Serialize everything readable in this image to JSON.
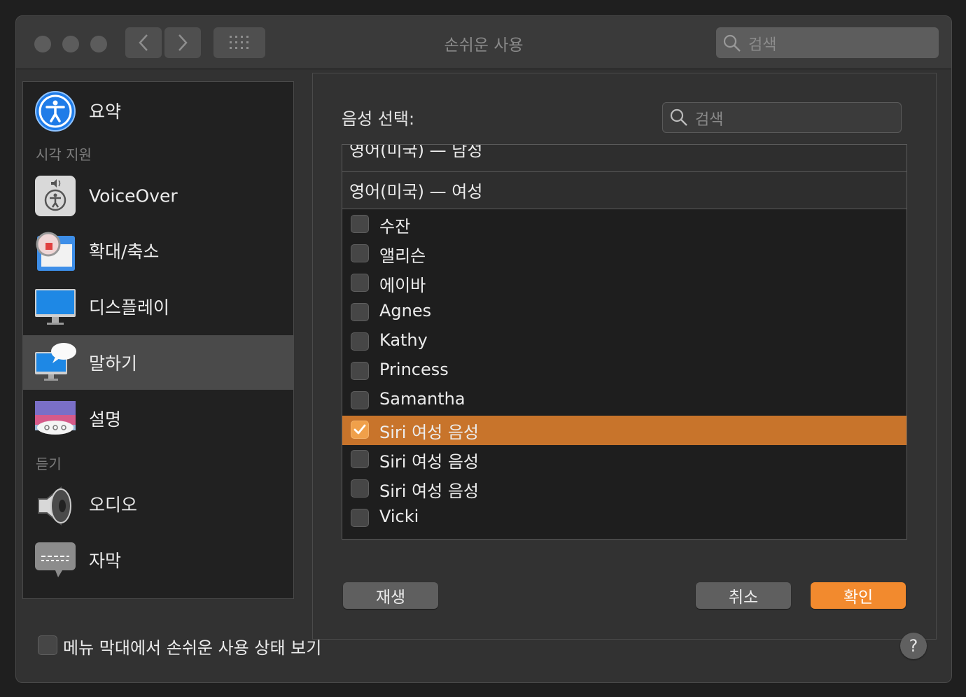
{
  "window": {
    "title": "손쉬운 사용",
    "search_placeholder": "검색"
  },
  "sidebar": {
    "items": [
      {
        "label": "요약",
        "icon": "accessibility-icon"
      },
      {
        "label": "VoiceOver",
        "icon": "voiceover-icon"
      },
      {
        "label": "확대/축소",
        "icon": "zoom-icon"
      },
      {
        "label": "디스플레이",
        "icon": "display-icon"
      },
      {
        "label": "말하기",
        "icon": "speech-icon",
        "selected": true
      },
      {
        "label": "설명",
        "icon": "descriptions-icon"
      },
      {
        "label": "오디오",
        "icon": "speaker-icon"
      },
      {
        "label": "자막",
        "icon": "captions-icon"
      }
    ],
    "sections": {
      "vision": "시각 지원",
      "hearing": "듣기"
    }
  },
  "sheet": {
    "label": "음성 선택:",
    "search_placeholder": "검색",
    "group_prev": "영어(미국) — 남성",
    "group_current": "영어(미국) — 여성",
    "voices": [
      {
        "name": "수잔",
        "checked": false
      },
      {
        "name": "앨리슨",
        "checked": false
      },
      {
        "name": "에이바",
        "checked": false
      },
      {
        "name": "Agnes",
        "checked": false
      },
      {
        "name": "Kathy",
        "checked": false
      },
      {
        "name": "Princess",
        "checked": false
      },
      {
        "name": "Samantha",
        "checked": false
      },
      {
        "name": "Siri 여성 음성",
        "checked": true,
        "selected": true
      },
      {
        "name": "Siri 여성 음성",
        "checked": false
      },
      {
        "name": "Siri 여성 음성",
        "checked": false
      },
      {
        "name": "Vicki",
        "checked": false
      }
    ],
    "buttons": {
      "play": "재생",
      "cancel": "취소",
      "ok": "확인"
    }
  },
  "footer": {
    "menu_bar_label": "메뉴 막대에서 손쉬운 사용 상태 보기",
    "help": "?"
  },
  "colors": {
    "accent": "#f28a2e",
    "selection": "#c8742b",
    "window_bg": "#323232"
  }
}
